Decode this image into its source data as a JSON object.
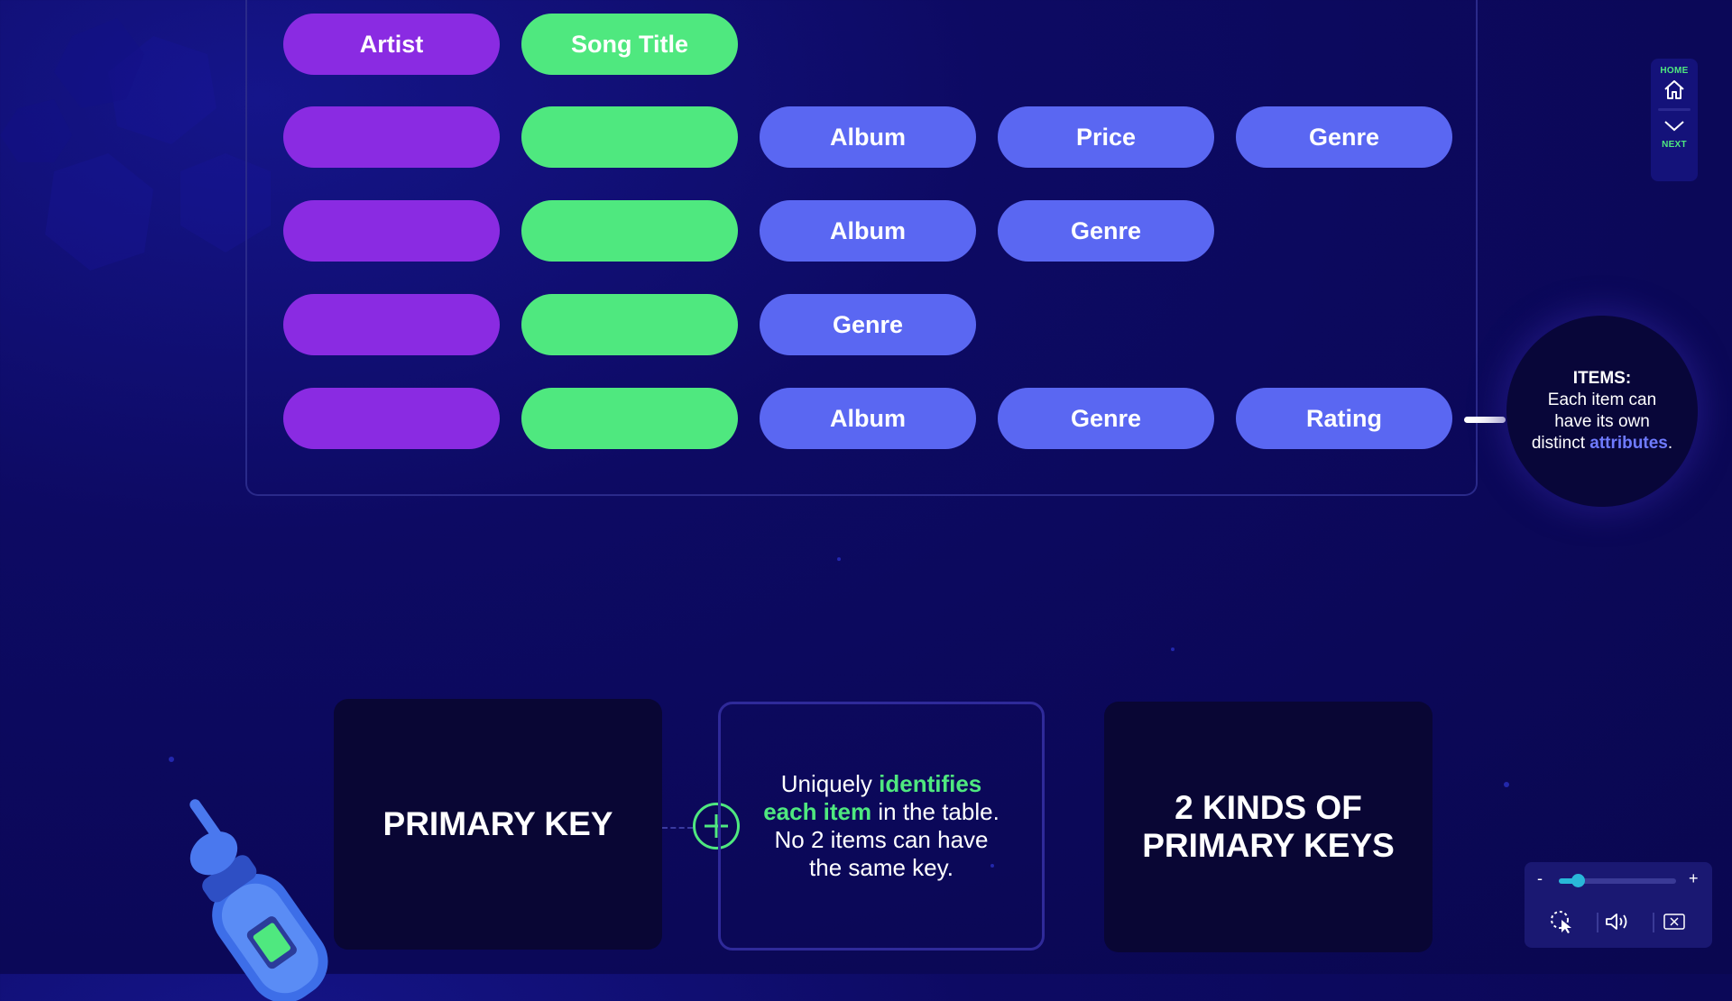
{
  "table": {
    "header": {
      "artist_label": "Artist",
      "song_title_label": "Song Title"
    },
    "rows": [
      {
        "attributes": [
          "Album",
          "Price",
          "Genre"
        ]
      },
      {
        "attributes": [
          "Album",
          "Genre"
        ]
      },
      {
        "attributes": [
          "Genre"
        ]
      },
      {
        "attributes": [
          "Album",
          "Genre",
          "Rating"
        ]
      }
    ]
  },
  "info_bubble": {
    "title": "ITEMS:",
    "line1": "Each item can",
    "line2": "have its own",
    "line3_prefix": "distinct ",
    "highlight": "attributes",
    "suffix": "."
  },
  "nav": {
    "home_label": "HOME",
    "next_label": "NEXT"
  },
  "cards": {
    "primary_key_title": "PRIMARY KEY",
    "description": {
      "part1": "Uniquely ",
      "highlight1": "identifies",
      "highlight2": "each item",
      "part2": " in the table.",
      "line3": "No 2 items can have",
      "line4": "the same key."
    },
    "kinds_line1": "2 KINDS OF",
    "kinds_line2": "PRIMARY KEYS"
  },
  "controls": {
    "minus": "-",
    "plus": "+",
    "zoom_level": 0.16
  },
  "colors": {
    "purple": "#8a2be2",
    "green": "#4fe87f",
    "blue": "#5a67f2",
    "background": "#0b0858"
  }
}
